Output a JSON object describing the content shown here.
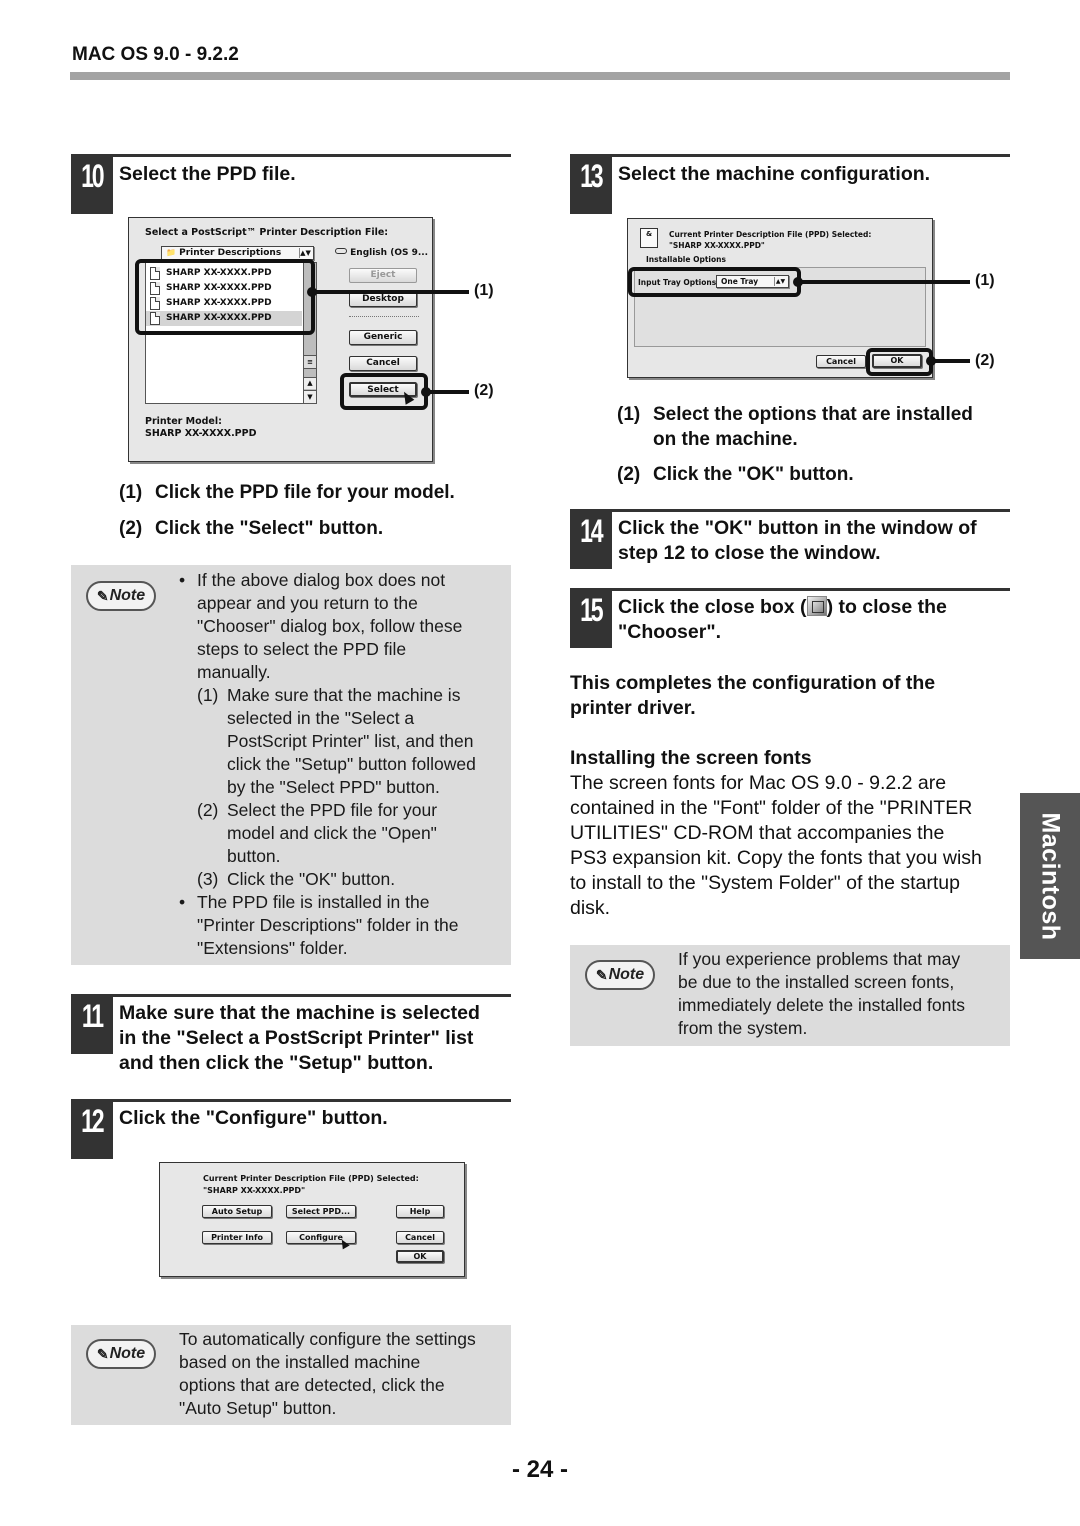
{
  "header": {
    "title": "MAC OS 9.0 - 9.2.2"
  },
  "steps": {
    "s10": {
      "number": "10",
      "title": "Select the PPD file.",
      "dialog": {
        "heading": "Select a PostScript™ Printer Description File:",
        "folder_popup": "Printer Descriptions",
        "disk_label": "English (OS 9...",
        "files": [
          "SHARP XX-XXXX.PPD",
          "SHARP XX-XXXX.PPD",
          "SHARP XX-XXXX.PPD",
          "SHARP XX-XXXX.PPD"
        ],
        "buttons": {
          "eject": "Eject",
          "desktop": "Desktop",
          "generic": "Generic",
          "cancel": "Cancel",
          "select": "Select"
        },
        "model_label": "Printer Model:",
        "model_value": "SHARP XX-XXXX.PPD"
      },
      "callouts": [
        "(1)",
        "(2)"
      ],
      "subitems": [
        {
          "n": "(1)",
          "text": "Click the PPD file for your model."
        },
        {
          "n": "(2)",
          "text": "Click the \"Select\" button."
        }
      ],
      "note": {
        "badge": "Note",
        "bullet1_lines": [
          "If the above dialog box does not",
          "appear and you return to the",
          "\"Chooser\" dialog box, follow these",
          "steps to select the PPD file",
          "manually."
        ],
        "sub": [
          {
            "n": "(1)",
            "lines": [
              "Make sure that the machine is",
              "selected in the \"Select a",
              "PostScript Printer\" list, and then",
              "click the \"Setup\" button followed",
              "by the \"Select PPD\" button."
            ]
          },
          {
            "n": "(2)",
            "lines": [
              "Select the PPD file for your",
              "model and click the \"Open\"",
              "button."
            ]
          },
          {
            "n": "(3)",
            "lines": [
              "Click the \"OK\" button."
            ]
          }
        ],
        "bullet2_lines": [
          "The PPD file is installed in the",
          "\"Printer Descriptions\" folder in the",
          "\"Extensions\" folder."
        ]
      }
    },
    "s11": {
      "number": "11",
      "title_lines": [
        "Make sure that the machine is selected",
        "in the \"Select a PostScript Printer\" list",
        "and then click the \"Setup\" button."
      ]
    },
    "s12": {
      "number": "12",
      "title": "Click the \"Configure\" button.",
      "dialog": {
        "heading": "Current Printer Description File (PPD) Selected:",
        "file": "\"SHARP XX-XXXX.PPD\"",
        "buttons": {
          "auto_setup": "Auto Setup",
          "select_ppd": "Select PPD...",
          "help": "Help",
          "printer_info": "Printer Info",
          "configure": "Configure",
          "cancel": "Cancel",
          "ok": "OK"
        }
      },
      "note": {
        "badge": "Note",
        "lines": [
          "To automatically configure the settings",
          "based on the installed machine",
          "options that are detected, click the",
          "\"Auto Setup\" button."
        ]
      }
    },
    "s13": {
      "number": "13",
      "title": "Select the machine configuration.",
      "dialog": {
        "heading": "Current Printer Description File (PPD) Selected:",
        "file": "\"SHARP XX-XXXX.PPD\"",
        "section": "Installable Options",
        "option_label": "Input Tray Options:",
        "option_value": "One Tray",
        "buttons": {
          "cancel": "Cancel",
          "ok": "OK"
        }
      },
      "callouts": [
        "(1)",
        "(2)"
      ],
      "subitems": [
        {
          "n": "(1)",
          "lines": [
            "Select the options that are installed",
            "on the machine."
          ]
        },
        {
          "n": "(2)",
          "lines": [
            "Click the \"OK\" button."
          ]
        }
      ]
    },
    "s14": {
      "number": "14",
      "title_lines": [
        "Click the \"OK\" button in the window of",
        "step 12 to close the window."
      ]
    },
    "s15": {
      "number": "15",
      "title_pre": "Click the close box (",
      "title_post": ") to close the",
      "title_line2": "\"Chooser\"."
    }
  },
  "completion": {
    "lines": [
      "This completes the configuration of the",
      "printer driver."
    ]
  },
  "fonts_section": {
    "heading": "Installing the screen fonts",
    "lines": [
      "The screen fonts for Mac OS 9.0 - 9.2.2 are",
      "contained in the \"Font\" folder of the \"PRINTER",
      "UTILITIES\" CD-ROM that accompanies the",
      "PS3 expansion kit. Copy the fonts that you wish",
      "to install to the \"System Folder\" of the startup",
      "disk."
    ],
    "note": {
      "badge": "Note",
      "lines": [
        "If you experience problems that may",
        "be due to the installed screen fonts,",
        "immediately delete the installed fonts",
        "from the system."
      ]
    }
  },
  "side_tab": "Macintosh",
  "page_number": "- 24 -"
}
